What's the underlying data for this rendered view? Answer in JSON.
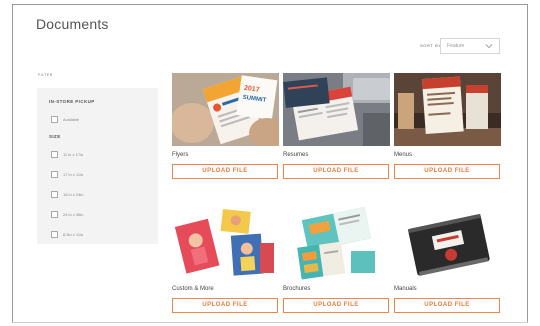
{
  "page": {
    "title": "Documents"
  },
  "sort": {
    "label": "SORT BY",
    "selected": "Feature"
  },
  "filter": {
    "heading": "FILTER",
    "groups": [
      {
        "title": "IN-STORE PICKUP",
        "options": [
          "Available"
        ]
      },
      {
        "title": "SIZE",
        "options": [
          "11 in x 17in",
          "17 in x 11in",
          "18 in x 24in",
          "24 in x 36in",
          "8.5in x 11in"
        ]
      }
    ]
  },
  "categories": [
    {
      "name": "Flyers",
      "button": "UPLOAD FILE"
    },
    {
      "name": "Resumes",
      "button": "UPLOAD FILE"
    },
    {
      "name": "Menus",
      "button": "UPLOAD FILE"
    },
    {
      "name": "Custom & More",
      "button": "UPLOAD FILE"
    },
    {
      "name": "Brochures",
      "button": "UPLOAD FILE"
    },
    {
      "name": "Manuals",
      "button": "UPLOAD FILE"
    }
  ],
  "colors": {
    "accent": "#ee7a36",
    "sidebar_bg": "#f3f3f3",
    "border": "#d6d6d6"
  },
  "icons": {
    "sort_chevron": "chevron-down-icon"
  }
}
